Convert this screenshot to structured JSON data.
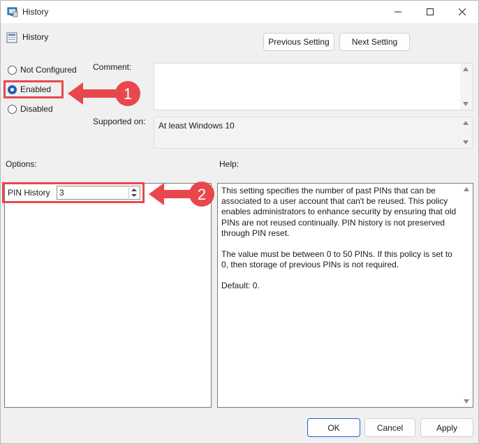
{
  "window": {
    "title": "History",
    "controls": {
      "minimize": "minimize",
      "maximize": "maximize",
      "close": "close"
    }
  },
  "header": {
    "policy_name": "History",
    "previous_label": "Previous Setting",
    "next_label": "Next Setting"
  },
  "state": {
    "options": [
      {
        "label": "Not Configured",
        "checked": false
      },
      {
        "label": "Enabled",
        "checked": true
      },
      {
        "label": "Disabled",
        "checked": false
      }
    ]
  },
  "comment": {
    "label": "Comment:",
    "value": ""
  },
  "supported": {
    "label": "Supported on:",
    "value": "At least Windows 10"
  },
  "options_section": {
    "label": "Options:",
    "pin_history_label": "PIN History",
    "pin_history_value": "3"
  },
  "help_section": {
    "label": "Help:",
    "paragraphs": [
      "This setting specifies the number of past PINs that can be associated to a user account that can't be reused. This policy enables administrators to enhance security by ensuring that old PINs are not reused continually. PIN history is not preserved through PIN reset.",
      "The value must be between 0 to 50 PINs. If this policy is set to 0, then storage of previous PINs is not required.",
      "Default: 0."
    ]
  },
  "footer": {
    "ok_label": "OK",
    "cancel_label": "Cancel",
    "apply_label": "Apply"
  },
  "annotations": {
    "callout_1": "1",
    "callout_2": "2",
    "color": "#e8484d"
  },
  "colors": {
    "accent": "#1f5fb8",
    "annotation": "#e8484d"
  }
}
